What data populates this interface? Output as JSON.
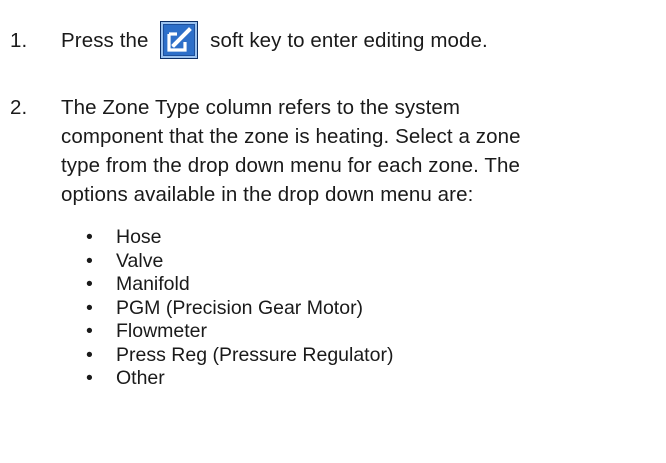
{
  "steps": [
    {
      "number": "1.",
      "text_before_icon": "Press the",
      "icon": "edit-softkey-icon",
      "text_after_icon": "soft key to enter editing mode."
    },
    {
      "number": "2.",
      "lines": [
        "The Zone Type column refers to the system",
        "component that the zone is heating. Select a zone",
        "type from the drop down menu for each zone. The",
        "options available in the drop down menu are:"
      ]
    }
  ],
  "bullet_symbol": "•",
  "zone_type_options": [
    "Hose",
    "Valve",
    "Manifold",
    "PGM (Precision Gear Motor)",
    "Flowmeter",
    "Press Reg (Pressure Regulator)",
    "Other"
  ],
  "colors": {
    "text": "#1a1a1a",
    "softkey_blue": "#2d6fc9",
    "softkey_border": "#0d2f66"
  }
}
